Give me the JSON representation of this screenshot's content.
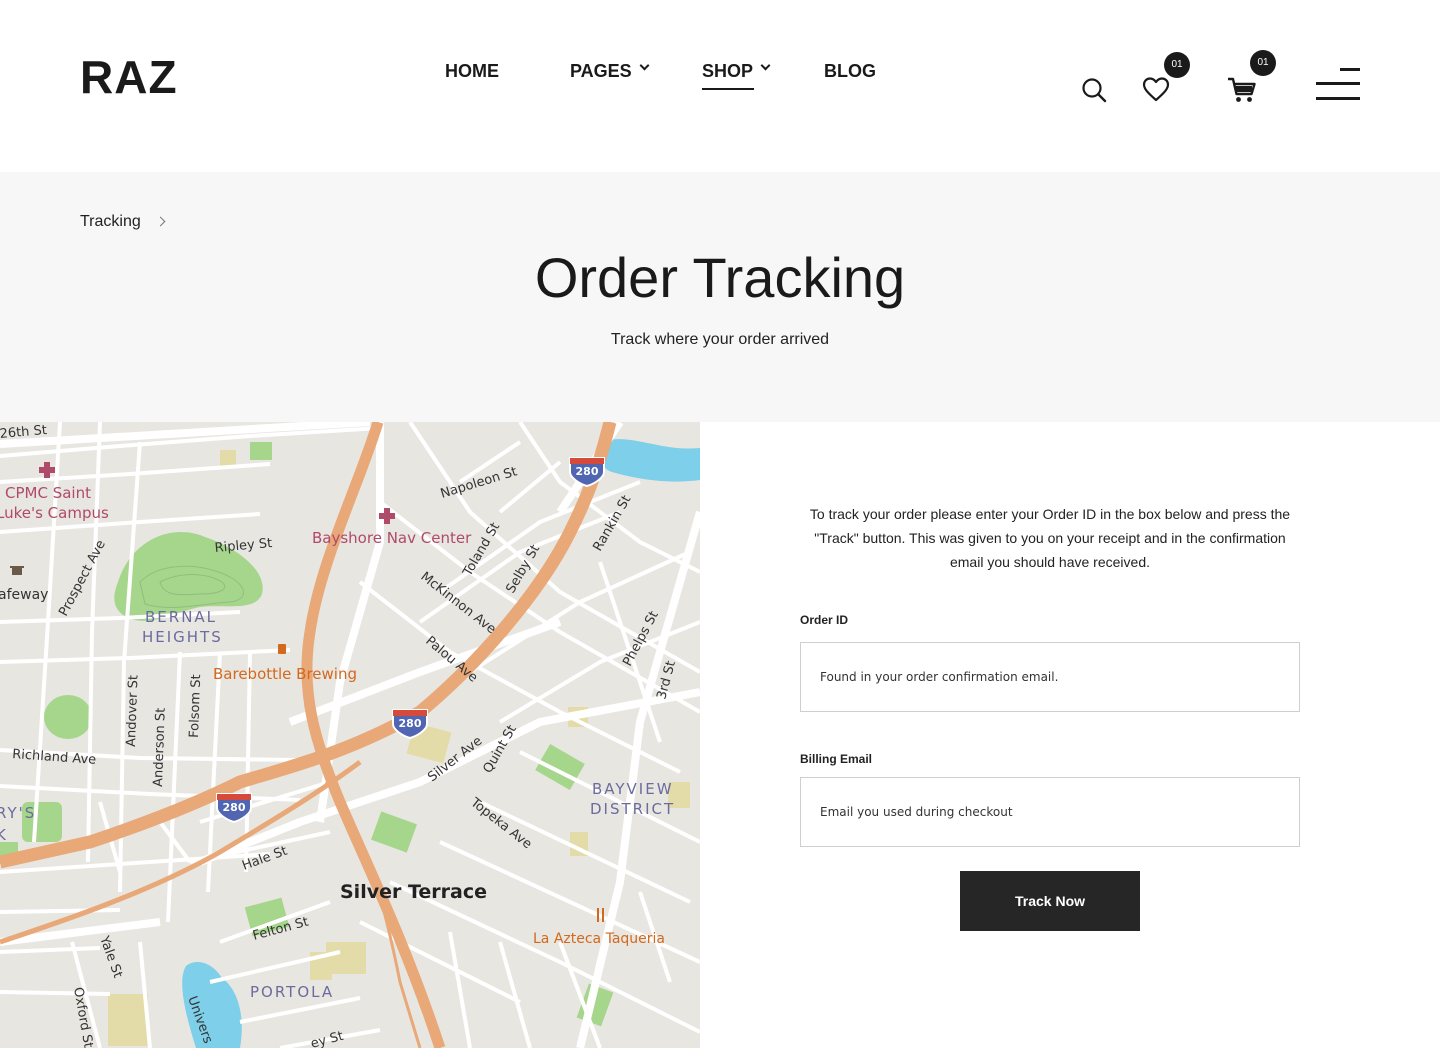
{
  "header": {
    "logo": "RAZ",
    "nav": [
      {
        "label": "HOME"
      },
      {
        "label": "PAGES"
      },
      {
        "label": "SHOP"
      },
      {
        "label": "BLOG"
      }
    ],
    "wishlist_count": "01",
    "cart_count": "01"
  },
  "banner": {
    "breadcrumb": "Tracking",
    "title": "Order Tracking",
    "subtitle": "Track where your order arrived"
  },
  "map": {
    "labels": {
      "st26": "26th St",
      "cpmc1": "CPMC Saint",
      "cpmc2": "Luke's Campus",
      "safeway": "afeway",
      "prospect": "Prospect Ave",
      "ripley": "Ripley St",
      "bernal1": "BERNAL",
      "bernal2": "HEIGHTS",
      "bayshore": "Bayshore Nav Center",
      "napoleon": "Napoleon St",
      "toland": "Toland St",
      "selby": "Selby St",
      "rankin": "Rankin St",
      "mckinnon": "McKinnon Ave",
      "palou": "Palou Ave",
      "phelps": "Phelps St",
      "third": "3rd St",
      "barebottle": "Barebottle Brewing",
      "andover": "Andover St",
      "anderson": "Anderson St",
      "folsom": "Folsom St",
      "richland": "Richland Ave",
      "silverave": "Silver Ave",
      "quint": "Quint St",
      "bayview1": "BAYVIEW",
      "bayview2": "DISTRICT",
      "topeka": "Topeka Ave",
      "rys": "RY'S",
      "k": "K",
      "hale": "Hale St",
      "silverterrace": "Silver Terrace",
      "felton": "Felton St",
      "yale": "Yale St",
      "oxford": "Oxford St",
      "univ": "Univers",
      "portola": "PORTOLA",
      "azteca": "La Azteca Taqueria",
      "bottom_st": "ey St"
    },
    "shields": {
      "s1": "280",
      "s2": "280",
      "s3": "280"
    }
  },
  "form": {
    "intro": "To track your order please enter your Order ID in the box below and press the \"Track\" button. This was given to you on your receipt and in the confirmation email you should have received.",
    "order_id_label": "Order ID",
    "order_id_placeholder": "Found in your order confirmation email.",
    "email_label": "Billing Email",
    "email_placeholder": "Email you used during checkout",
    "button": "Track Now"
  },
  "colors": {
    "accent": "#1a1a1a",
    "banner_bg": "#f7f7f7",
    "button_bg": "#262626",
    "map_bg": "#e8e6e1",
    "highway": "#e8a878",
    "park": "#a6d68c",
    "water": "#7dcfea"
  },
  "icons": [
    "search-icon",
    "heart-icon",
    "cart-icon",
    "menu-icon",
    "chevron-down-icon",
    "chevron-right-icon",
    "hospital-icon",
    "shop-icon",
    "beer-icon",
    "restaurant-icon"
  ]
}
